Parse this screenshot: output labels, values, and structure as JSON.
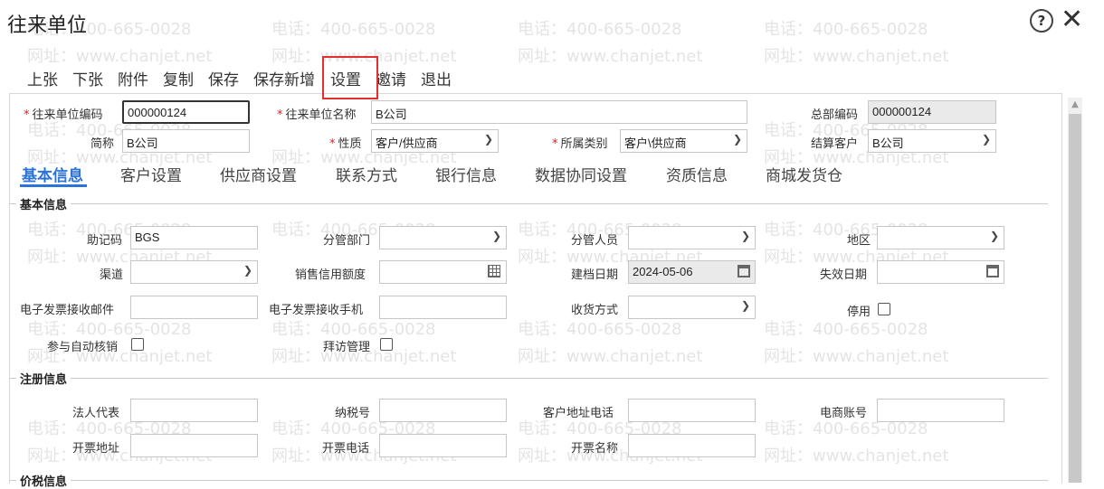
{
  "window": {
    "title": "往来单位"
  },
  "watermark": {
    "phone": "电话：400-665-0028",
    "site": "网址：www.chanjet.net"
  },
  "toolbar": {
    "up": "上张",
    "down": "下张",
    "attach": "附件",
    "copy": "复制",
    "save": "保存",
    "save_new": "保存新增",
    "settings": "设置",
    "invite": "邀请",
    "exit": "退出"
  },
  "header": {
    "code_label": "往来单位编码",
    "code_value": "000000124",
    "name_label": "往来单位名称",
    "name_value": "B公司",
    "hq_label": "总部编码",
    "hq_value": "000000124",
    "short_label": "简称",
    "short_value": "B公司",
    "nature_label": "性质",
    "nature_value": "客户/供应商",
    "category_label": "所属类别",
    "category_value": "客户\\供应商",
    "settle_label": "结算客户",
    "settle_value": "B公司"
  },
  "tabs": [
    "基本信息",
    "客户设置",
    "供应商设置",
    "联系方式",
    "银行信息",
    "数据协同设置",
    "资质信息",
    "商城发货仓"
  ],
  "basic": {
    "section_title": "基本信息",
    "mnemonic_label": "助记码",
    "mnemonic_value": "BGS",
    "dept_label": "分管部门",
    "dept_value": "",
    "staff_label": "分管人员",
    "staff_value": "",
    "region_label": "地区",
    "region_value": "",
    "channel_label": "渠道",
    "channel_value": "",
    "credit_label": "销售信用额度",
    "credit_value": "",
    "created_label": "建档日期",
    "created_value": "2024-05-06",
    "expire_label": "失效日期",
    "expire_value": "",
    "einvoice_mail_label": "电子发票接收邮件",
    "einvoice_mail_value": "",
    "einvoice_phone_label": "电子发票接收手机",
    "einvoice_phone_value": "",
    "delivery_label": "收货方式",
    "delivery_value": "",
    "disabled_label": "停用",
    "auto_verify_label": "参与自动核销",
    "visit_label": "拜访管理"
  },
  "registration": {
    "section_title": "注册信息",
    "legal_label": "法人代表",
    "legal_value": "",
    "tax_label": "纳税号",
    "tax_value": "",
    "addr_phone_label": "客户地址电话",
    "addr_phone_value": "",
    "ecom_label": "电商账号",
    "ecom_value": "",
    "inv_addr_label": "开票地址",
    "inv_addr_value": "",
    "inv_phone_label": "开票电话",
    "inv_phone_value": "",
    "inv_name_label": "开票名称",
    "inv_name_value": ""
  },
  "tax_section": {
    "section_title": "价税信息"
  },
  "colors": {
    "accent": "#2a73d9",
    "highlight": "#e03030",
    "required": "#e02020"
  }
}
